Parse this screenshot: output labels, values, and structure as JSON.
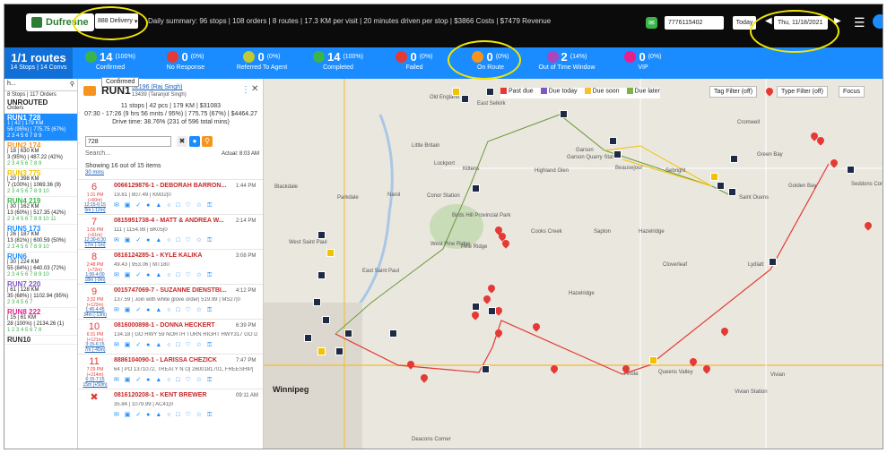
{
  "topbar": {
    "logo": "Dufresne",
    "delivery_select": "888 Delivery",
    "summary": "Daily summary: 96 stops | 108 orders | 8 routes | 17.3 KM per visit | 20 minutes driven per stop | $3866 Costs | $7479 Revenue",
    "phone": "7776115402",
    "today": "Today",
    "date": "Thu, 11/18/2021"
  },
  "statusbar": {
    "routes_title": "1/1 routes",
    "routes_sub": "14 Stops | 14 Convs",
    "stats": [
      {
        "num": "14",
        "pct": "(100%)",
        "label": "Confirmed",
        "color": "#3bb54a"
      },
      {
        "num": "0",
        "pct": "(0%)",
        "label": "No Response",
        "color": "#e53935"
      },
      {
        "num": "0",
        "pct": "(0%)",
        "label": "Referred To Agent",
        "color": "#c0ca33"
      },
      {
        "num": "14",
        "pct": "(100%)",
        "label": "Completed",
        "color": "#3bb54a"
      },
      {
        "num": "0",
        "pct": "(0%)",
        "label": "Failed",
        "color": "#e53935"
      },
      {
        "num": "0",
        "pct": "(0%)",
        "label": "On Route",
        "color": "#f7941d"
      },
      {
        "num": "2",
        "pct": "(14%)",
        "label": "Out of Time Window",
        "color": "#ab47bc"
      },
      {
        "num": "0",
        "pct": "(0%)",
        "label": "VIP",
        "color": "#e91e8c"
      }
    ],
    "tooltip": "Confirmed"
  },
  "leftpanel": {
    "search": "h...",
    "sub": "8 Stops | 117 Orders",
    "unrouted": "UNROUTED",
    "unrouted_sub": "Orders",
    "routes": [
      {
        "name": "RUN1 728",
        "l1": "1 | 42 | 179 KM",
        "l2": "56 (95%) | 775.75 (67%)",
        "l3": "2 3 4 5 6 7 8 9",
        "selected": true
      },
      {
        "name": "RUN2 174",
        "l1": "| 18 | 630 KM",
        "l2": "3 (95%) | 487.22 (42%)",
        "l3": "2 3 4 5 6 7 8 9",
        "selected": false
      },
      {
        "name": "RUN3 775",
        "l1": "| 20 | 398 KM",
        "l2": "7 (100%) | 1069.36 (9)",
        "l3": "2 3 4 5 6 7 8 9 10",
        "selected": false
      },
      {
        "name": "RUN4 219",
        "l1": "| 30 | 162 KM",
        "l2": "13 (60%) | 517.35 (42%)",
        "l3": "2 3 4 5 6 7 8 9 10 11",
        "selected": false
      },
      {
        "name": "RUN5 173",
        "l1": "| 26 | 187 KM",
        "l2": "13 (81%) | 600.59 (50%)",
        "l3": "2 3 4 5 6 7 8 9 10",
        "selected": false
      },
      {
        "name": "RUN6",
        "l1": "| 30 | 224 KM",
        "l2": "55 (84%) | 640.03 (72%)",
        "l3": "2 3 4 5 6 7 8 9 10",
        "selected": false
      },
      {
        "name": "RUN7 220",
        "l1": "| 61 | 128 KM",
        "l2": "35 (68%) | 1102.94 (95%)",
        "l3": "2 3 4 5 6 7",
        "selected": false
      },
      {
        "name": "RUN8 222",
        "l1": "| 15 | 61 KM",
        "l2": "28 (100%) | 2134.26 (1)",
        "l3": "1 2 3 4 5 6 7 8",
        "selected": false
      },
      {
        "name": "RUN10",
        "l1": "",
        "l2": "",
        "l3": "",
        "selected": false
      }
    ]
  },
  "routepanel": {
    "title": "RUN1",
    "driver": "32196 (Raj Singh)",
    "driver_sub": "13439 (Taranjot Singh)",
    "line1": "11 stops | 42 pcs | 179 KM | $31083",
    "line2": "07:30 - 17:26 (9 hrs 56 mnts / 95%) | 775.75 (67%) | $4464.27",
    "line3": "Drive time: 38.76% (231 of 596 total mins)",
    "search_value": "728",
    "search_placeholder": "Search...",
    "actual": "Actual: 8:03 AM",
    "showing": "Showing 16 out of 15 items",
    "thirty_min": "30 mins",
    "stops": [
      {
        "no": "6",
        "t1": "1:31 PM (+60m)",
        "t2": "12:15-6:15 0m (-12m)",
        "name": "0066129876-1 - DEBORAH BARRON...",
        "time": "1:44 PM",
        "det": "19.81 | 807.49 | KM32|0"
      },
      {
        "no": "7",
        "t1": "1:56 PM (+61m)",
        "t2": "12:30-6:30 17m (-1m)",
        "name": "0815951738-4 - MATT & ANDREA W...",
        "time": "2:14 PM",
        "det": "111 | 1154.99 | BK05|0"
      },
      {
        "no": "8",
        "t1": "2:48 PM (+72m)",
        "t2": "1:00-4:00 18m (-9m)",
        "name": "0816124285-1 - KYLE KALIKA",
        "time": "3:08 PM",
        "det": "49.43 | 953.06 | MT180"
      },
      {
        "no": "9",
        "t1": "3:32 PM (+122m)",
        "t2": "1:45-4:45 34m (-13m)",
        "name": "0015747069-7 - SUZANNE DIENSTBI...",
        "time": "4:12 PM",
        "det": "137.59 | Join with white glove order| 519.99 | MS27|0"
      },
      {
        "no": "10",
        "t1": "6:31 PM (+121m)",
        "t2": "3:15-6:15 7m (-45m)",
        "name": "0816000898-1 - DONNA HECKERT",
        "time": "6:39 PM",
        "det": "134.18 | GO HWY 59 NORTH TURN RIGHT HWY317 GO D"
      },
      {
        "no": "11",
        "t1": "7:29 PM (+214m)",
        "t2": "6:15-7:15 15m (+50m)",
        "name": "8886104090-1 - LARISSA CHEZICK",
        "time": "7:47 PM",
        "det": "64 | PO 1371072, TREATY N O| 2600181701, FREESHIP|"
      },
      {
        "no": "",
        "t1": "",
        "t2": "",
        "name": "0816120208-1 - KENT BREWER",
        "time": "09:11 AM",
        "det": "35.84 | 1079.99 | AC41|0"
      }
    ]
  },
  "map": {
    "legend": [
      {
        "label": "Past due",
        "color": "#e53935"
      },
      {
        "label": "Due today",
        "color": "#7e57c2"
      },
      {
        "label": "Due soon",
        "color": "#fbc02d"
      },
      {
        "label": "Due later",
        "color": "#7cb342"
      }
    ],
    "tag_filter": "Tag Filter (off)",
    "type_filter": "Type Filter (off)",
    "focus": "Focus",
    "places": [
      "East Selkirk",
      "Old England",
      "Little Britain",
      "Lockport",
      "Garson",
      "Garson Quarry Station",
      "Cromwell",
      "Green Bay",
      "Highland Glen",
      "Beausejour",
      "Sebright",
      "Golden Bay",
      "Seddons Corner",
      "Blackdale",
      "Parkdale",
      "Narol",
      "Conor Station",
      "Kittens",
      "Saint Ouens",
      "Birds Hill Provincial Park",
      "Cooks Creek",
      "Sapton",
      "Hazelridge",
      "West Saint Paul",
      "West Pine Ridge",
      "Pine Ridge",
      "Cloverleaf",
      "Lydiatt",
      "East Saint Paul",
      "Hazelridge",
      "Winnipeg",
      "Vivian",
      "Vivian Station",
      "Queens Valley",
      "Anola",
      "Deacons Corner"
    ]
  }
}
